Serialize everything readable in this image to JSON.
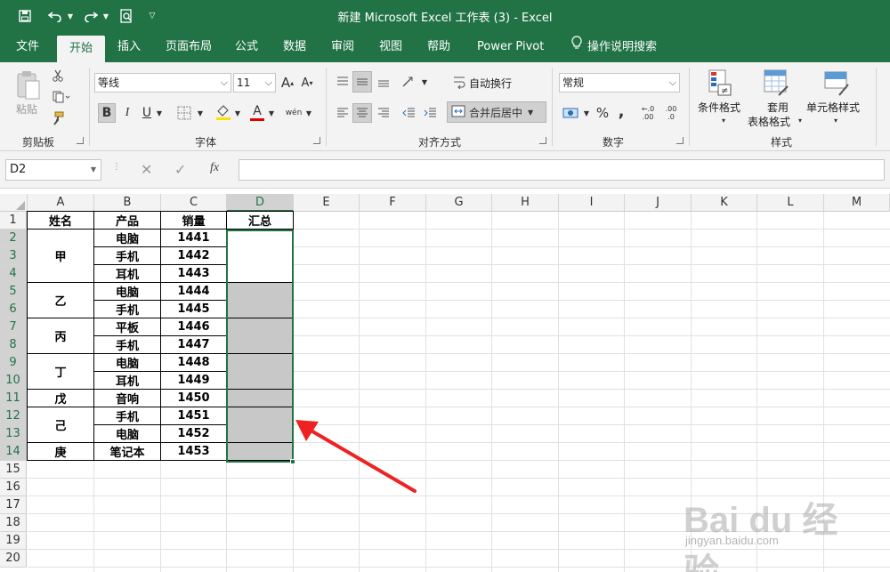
{
  "title": "新建 Microsoft Excel 工作表 (3)  -  Excel",
  "tabs": [
    "文件",
    "开始",
    "插入",
    "页面布局",
    "公式",
    "数据",
    "审阅",
    "视图",
    "帮助",
    "Power Pivot",
    "操作说明搜索"
  ],
  "active_tab": "开始",
  "colors": {
    "brand": "#217346",
    "selected_fill": "#c8c8c8"
  },
  "ribbon": {
    "clipboard": {
      "paste_label": "粘贴",
      "group_label": "剪贴板"
    },
    "font": {
      "font_name": "等线",
      "font_size": "11",
      "grow_label": "A",
      "shrink_label": "A",
      "bold": "B",
      "italic": "I",
      "underline": "U",
      "color_a": "A",
      "phonetic": "wén",
      "group_label": "字体"
    },
    "align": {
      "wrap_label": "自动换行",
      "merge_label": "合并后居中",
      "group_label": "对齐方式"
    },
    "number": {
      "format": "常规",
      "percent": "%",
      "comma": ",",
      "inc_dec": ".00",
      "dec_dec": ".0",
      "group_label": "数字"
    },
    "styles": {
      "conditional_label": "条件格式",
      "table_label_1": "套用",
      "table_label_2": "表格格式",
      "cell_style_label": "单元格样式",
      "group_label": "样式"
    }
  },
  "formula_bar": {
    "name_box": "D2",
    "fx": "fx",
    "formula": ""
  },
  "columns": [
    "A",
    "B",
    "C",
    "D",
    "E",
    "F",
    "G",
    "H",
    "I",
    "J",
    "K",
    "L",
    "M"
  ],
  "rows": [
    "1",
    "2",
    "3",
    "4",
    "5",
    "6",
    "7",
    "8",
    "9",
    "10",
    "11",
    "12",
    "13",
    "14",
    "15",
    "16",
    "17",
    "18",
    "19",
    "20"
  ],
  "sheet": {
    "headers": [
      "姓名",
      "产品",
      "销量",
      "汇总"
    ],
    "names": [
      "甲",
      "乙",
      "丙",
      "丁",
      "戊",
      "己",
      "庚"
    ],
    "products": [
      "电脑",
      "手机",
      "耳机",
      "电脑",
      "手机",
      "平板",
      "手机",
      "电脑",
      "耳机",
      "音响",
      "手机",
      "电脑",
      "笔记本"
    ],
    "sales": [
      "1441",
      "1442",
      "1443",
      "1444",
      "1445",
      "1446",
      "1447",
      "1448",
      "1449",
      "1450",
      "1451",
      "1452",
      "1453"
    ]
  },
  "watermark": {
    "logo": "Bai du 经验",
    "url": "jingyan.baidu.com"
  }
}
